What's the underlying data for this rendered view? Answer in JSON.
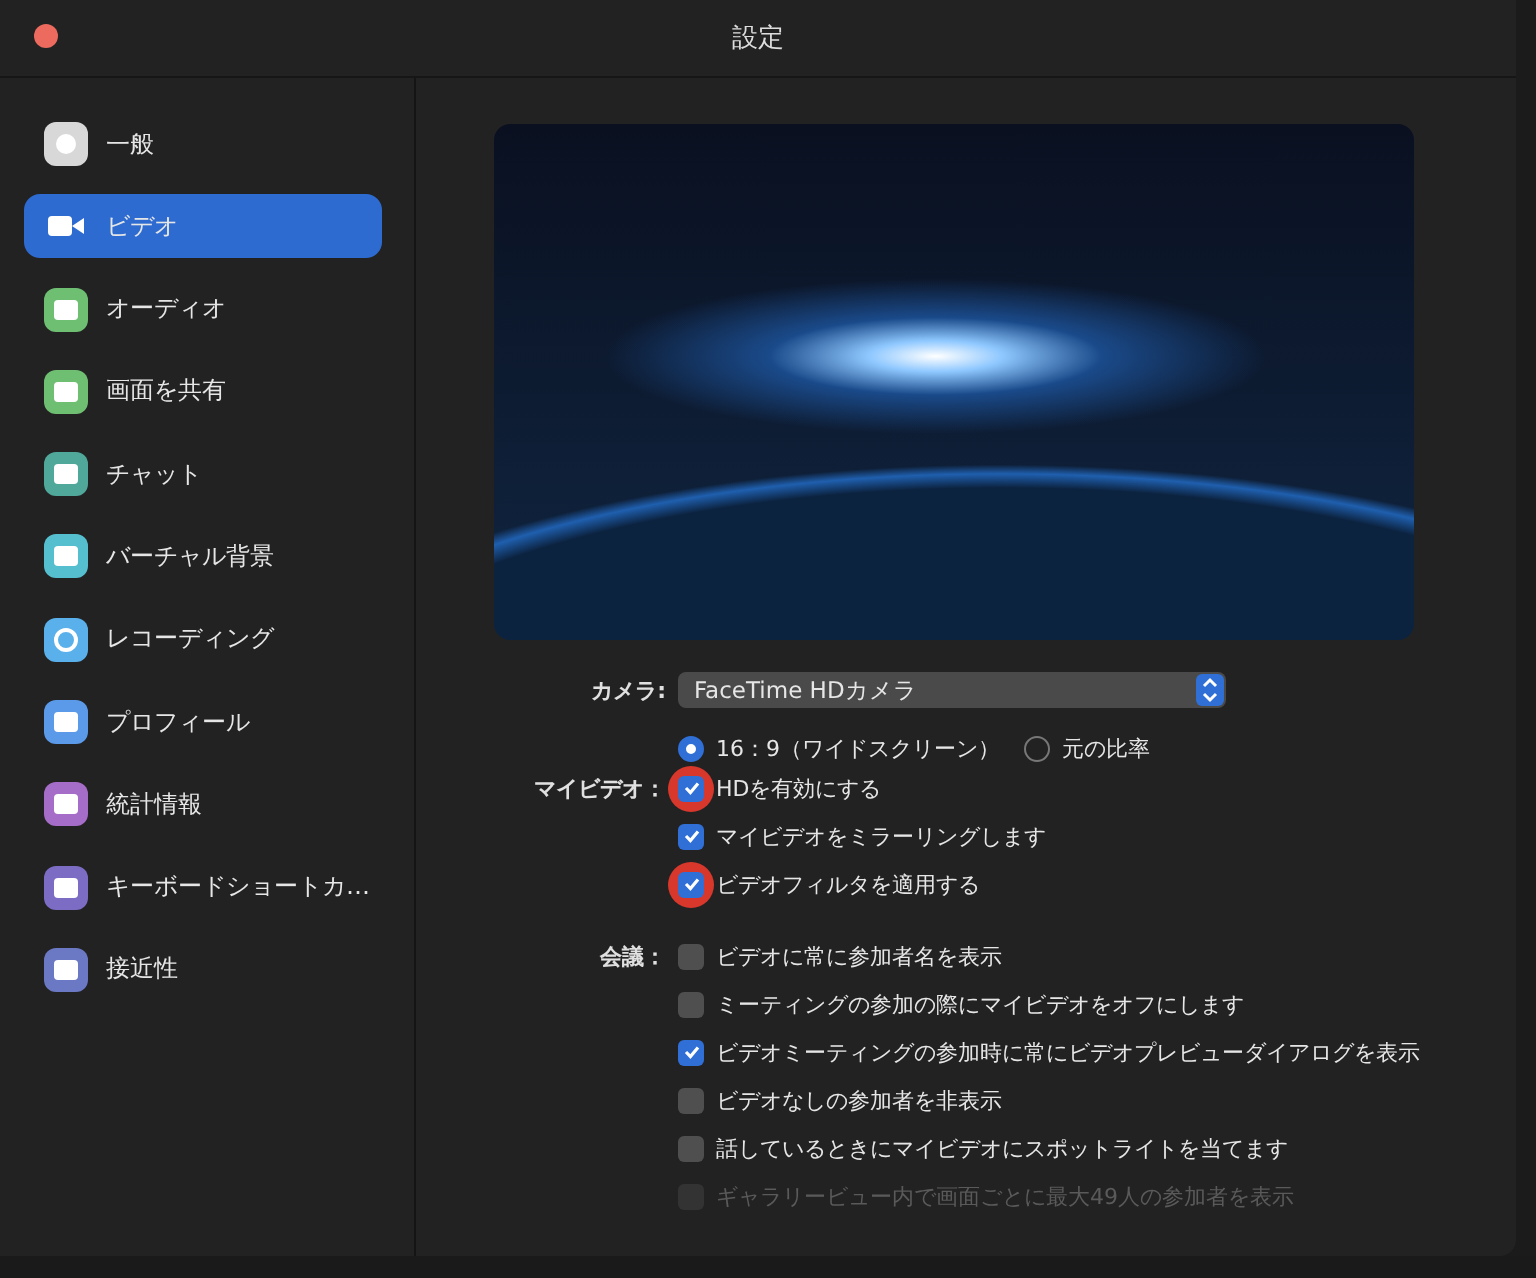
{
  "window": {
    "title": "設定"
  },
  "sidebar": {
    "items": [
      {
        "label": "一般",
        "selected": false,
        "color": "#d8d8d8"
      },
      {
        "label": "ビデオ",
        "selected": true
      },
      {
        "label": "オーディオ",
        "selected": false,
        "color": "#6fbf73"
      },
      {
        "label": "画面を共有",
        "selected": false,
        "color": "#6fbf73"
      },
      {
        "label": "チャット",
        "selected": false,
        "color": "#4fa89a"
      },
      {
        "label": "バーチャル背景",
        "selected": false,
        "color": "#55bfcf"
      },
      {
        "label": "レコーディング",
        "selected": false,
        "color": "#5ab0ea"
      },
      {
        "label": "プロフィール",
        "selected": false,
        "color": "#5a9ae8"
      },
      {
        "label": "統計情報",
        "selected": false,
        "color": "#a56cc8"
      },
      {
        "label": "キーボードショートカ…",
        "selected": false,
        "color": "#7c6cc4"
      },
      {
        "label": "接近性",
        "selected": false,
        "color": "#6b78c4"
      }
    ]
  },
  "camera": {
    "label": "カメラ:",
    "value": "FaceTime HDカメラ"
  },
  "my_video": {
    "label": "マイビデオ：",
    "ratios": [
      {
        "label": "16：9（ワイドスクリーン）",
        "selected": true
      },
      {
        "label": "元の比率",
        "selected": false
      }
    ],
    "options": [
      {
        "label": "HDを有効にする",
        "checked": true,
        "highlighted": true
      },
      {
        "label": "マイビデオをミラーリングします",
        "checked": true,
        "highlighted": false
      },
      {
        "label": "ビデオフィルタを適用する",
        "checked": true,
        "highlighted": true
      }
    ]
  },
  "meeting": {
    "label": "会議：",
    "options": [
      {
        "label": "ビデオに常に参加者名を表示",
        "checked": false,
        "disabled": false
      },
      {
        "label": "ミーティングの参加の際にマイビデオをオフにします",
        "checked": false,
        "disabled": false
      },
      {
        "label": "ビデオミーティングの参加時に常にビデオプレビューダイアログを表示",
        "checked": true,
        "disabled": false
      },
      {
        "label": "ビデオなしの参加者を非表示",
        "checked": false,
        "disabled": false
      },
      {
        "label": "話しているときにマイビデオにスポットライトを当てます",
        "checked": false,
        "disabled": false
      },
      {
        "label": "ギャラリービュー内で画面ごとに最大49人の参加者を表示",
        "checked": false,
        "disabled": true
      }
    ]
  }
}
